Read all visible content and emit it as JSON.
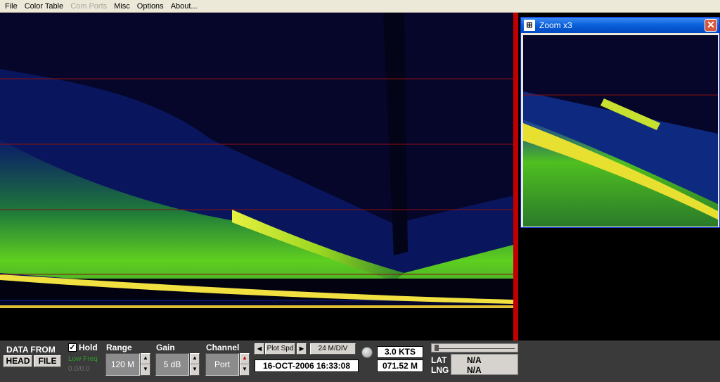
{
  "menu": [
    {
      "label": "File",
      "enabled": true
    },
    {
      "label": "Color Table",
      "enabled": true
    },
    {
      "label": "Com Ports",
      "enabled": false
    },
    {
      "label": "Misc",
      "enabled": true
    },
    {
      "label": "Options",
      "enabled": true
    },
    {
      "label": "About...",
      "enabled": true
    }
  ],
  "zoom": {
    "title": "Zoom x3",
    "close": "✕"
  },
  "panel": {
    "data_from_label": "DATA FROM",
    "head_button": "HEAD",
    "file_button": "FILE",
    "hold_label": "Hold",
    "hold_checked": true,
    "low_freq_label": "Low Freq",
    "counter": "0.0/0.0",
    "range_label": "Range",
    "range_value": "120 M",
    "gain_label": "Gain",
    "gain_value": "5 dB",
    "channel_label": "Channel",
    "channel_value": "Port",
    "plot_spd_label": "Plot Spd",
    "div_value": "24 M/DIV",
    "datetime": "16-OCT-2006  16:33:08",
    "speed": "3.0 KTS",
    "distance": "071.52 M",
    "lat_label": "LAT",
    "lng_label": "LNG",
    "lat_value": "N/A",
    "lng_value": "N/A"
  },
  "colors": {
    "background": "#06062a",
    "red_lines": "#8a1010",
    "divider": "#c00000",
    "panel": "#3a3a3a",
    "low_freq": "#2e9a2e"
  }
}
